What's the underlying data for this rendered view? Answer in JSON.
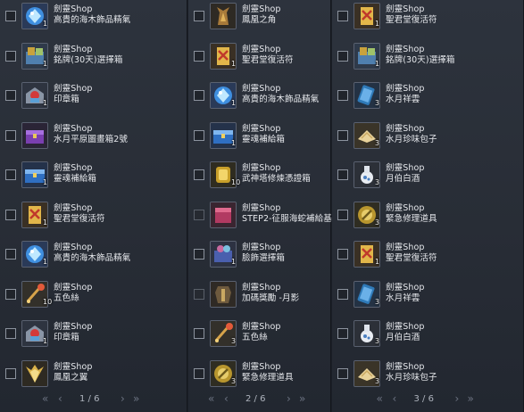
{
  "colors": {
    "panel_bg": "#2a3039",
    "text": "#e6e8ec",
    "page_text": "#aeb4bd",
    "arrow": "#6b7280"
  },
  "pager_arrows": {
    "first": "«",
    "prev": "‹",
    "next": "›",
    "last": "»"
  },
  "panels": [
    {
      "page": "1 / 6",
      "items": [
        {
          "source": "劍靈Shop",
          "name": "高貴的海木飾品精氣",
          "qty": "1",
          "icon": "blue-gem-icon"
        },
        {
          "source": "劍靈Shop",
          "name": "銘牌(30天)選擇箱",
          "qty": "1",
          "icon": "nameplate-box-icon"
        },
        {
          "source": "劍靈Shop",
          "name": "印章箱",
          "qty": "1",
          "icon": "seal-box-icon"
        },
        {
          "source": "劍靈Shop",
          "name": "水月平原圖畫箱2號",
          "qty": "",
          "icon": "purple-chest-icon"
        },
        {
          "source": "劍靈Shop",
          "name": "靈魂補給箱",
          "qty": "1",
          "icon": "blue-chest-icon"
        },
        {
          "source": "劍靈Shop",
          "name": "聖君堂復活符",
          "qty": "1",
          "icon": "revival-charm-icon"
        },
        {
          "source": "劍靈Shop",
          "name": "高貴的海木飾品精氣",
          "qty": "1",
          "icon": "blue-gem-icon"
        },
        {
          "source": "劍靈Shop",
          "name": "五色絲",
          "qty": "10",
          "icon": "silk-thread-icon"
        },
        {
          "source": "劍靈Shop",
          "name": "印章箱",
          "qty": "1",
          "icon": "seal-box-icon"
        },
        {
          "source": "劍靈Shop",
          "name": "鳳凰之翼",
          "qty": "",
          "icon": "phoenix-wing-icon"
        }
      ]
    },
    {
      "page": "2 / 6",
      "items": [
        {
          "source": "劍靈Shop",
          "name": "鳳凰之角",
          "qty": "",
          "icon": "phoenix-horn-icon"
        },
        {
          "source": "劍靈Shop",
          "name": "聖君堂復活符",
          "qty": "1",
          "icon": "revival-charm-icon"
        },
        {
          "source": "劍靈Shop",
          "name": "高貴的海木飾品精氣",
          "qty": "1",
          "icon": "blue-gem-icon"
        },
        {
          "source": "劍靈Shop",
          "name": "靈魂補給箱",
          "qty": "1",
          "icon": "blue-chest-icon"
        },
        {
          "source": "劍靈Shop",
          "name": "武神塔修煉憑證箱",
          "qty": "10",
          "icon": "gold-token-box-icon"
        },
        {
          "source": "劍靈Shop",
          "name": "STEP2-征服海蛇補給基",
          "qty": "",
          "icon": "red-supply-icon",
          "dim": true
        },
        {
          "source": "劍靈Shop",
          "name": "臉飾選擇箱",
          "qty": "1",
          "icon": "face-accessory-box-icon"
        },
        {
          "source": "劍靈Shop",
          "name": "加碼獎勵 -月影",
          "qty": "",
          "icon": "costume-icon",
          "dim": true
        },
        {
          "source": "劍靈Shop",
          "name": "五色絲",
          "qty": "3",
          "icon": "silk-thread-icon"
        },
        {
          "source": "劍靈Shop",
          "name": "緊急修理道具",
          "qty": "3",
          "icon": "repair-tool-icon"
        }
      ]
    },
    {
      "page": "3 / 6",
      "items": [
        {
          "source": "劍靈Shop",
          "name": "聖君堂復活符",
          "qty": "1",
          "icon": "revival-charm-icon"
        },
        {
          "source": "劍靈Shop",
          "name": "銘牌(30天)選擇箱",
          "qty": "1",
          "icon": "nameplate-box-icon"
        },
        {
          "source": "劍靈Shop",
          "name": "水月祥雲",
          "qty": "3",
          "icon": "blue-scroll-icon"
        },
        {
          "source": "劍靈Shop",
          "name": "水月珍味包子",
          "qty": "3",
          "icon": "dumpling-icon"
        },
        {
          "source": "劍靈Shop",
          "name": "月伯白酒",
          "qty": "3",
          "icon": "wine-bottle-icon"
        },
        {
          "source": "劍靈Shop",
          "name": "緊急修理道具",
          "qty": "3",
          "icon": "repair-tool-icon"
        },
        {
          "source": "劍靈Shop",
          "name": "聖君堂復活符",
          "qty": "1",
          "icon": "revival-charm-icon"
        },
        {
          "source": "劍靈Shop",
          "name": "水月祥雲",
          "qty": "3",
          "icon": "blue-scroll-icon"
        },
        {
          "source": "劍靈Shop",
          "name": "月伯白酒",
          "qty": "3",
          "icon": "wine-bottle-icon"
        },
        {
          "source": "劍靈Shop",
          "name": "水月珍味包子",
          "qty": "3",
          "icon": "dumpling-icon"
        }
      ]
    }
  ]
}
